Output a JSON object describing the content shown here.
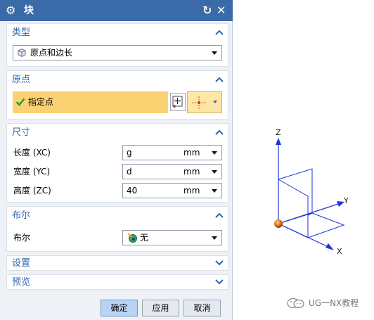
{
  "dialog": {
    "title": "块",
    "colors": {
      "titlebar": "#3b6aa8",
      "section_title": "#2b66b0",
      "highlight": "#fbd271"
    }
  },
  "sections": {
    "type": {
      "title": "类型",
      "selected": "原点和边长",
      "icon": "cube-icon"
    },
    "origin": {
      "title": "原点",
      "point_label": "指定点",
      "check_icon": "checkmark-icon"
    },
    "dimensions": {
      "title": "尺寸",
      "rows": [
        {
          "label": "长度 (XC)",
          "value": "g",
          "unit": "mm"
        },
        {
          "label": "宽度 (YC)",
          "value": "d",
          "unit": "mm"
        },
        {
          "label": "高度 (ZC)",
          "value": "40",
          "unit": "mm"
        }
      ]
    },
    "boolean": {
      "title": "布尔",
      "label": "布尔",
      "value": "无"
    },
    "settings": {
      "title": "设置"
    },
    "preview": {
      "title": "预览"
    }
  },
  "buttons": {
    "ok": "确定",
    "apply": "应用",
    "cancel": "取消"
  },
  "viewport": {
    "axis_x": "X",
    "axis_y": "Y",
    "axis_z": "Z",
    "axis_color": "#1a35d6",
    "origin_color": "#e07a1a"
  },
  "watermark": {
    "text": "UG一NX教程"
  }
}
